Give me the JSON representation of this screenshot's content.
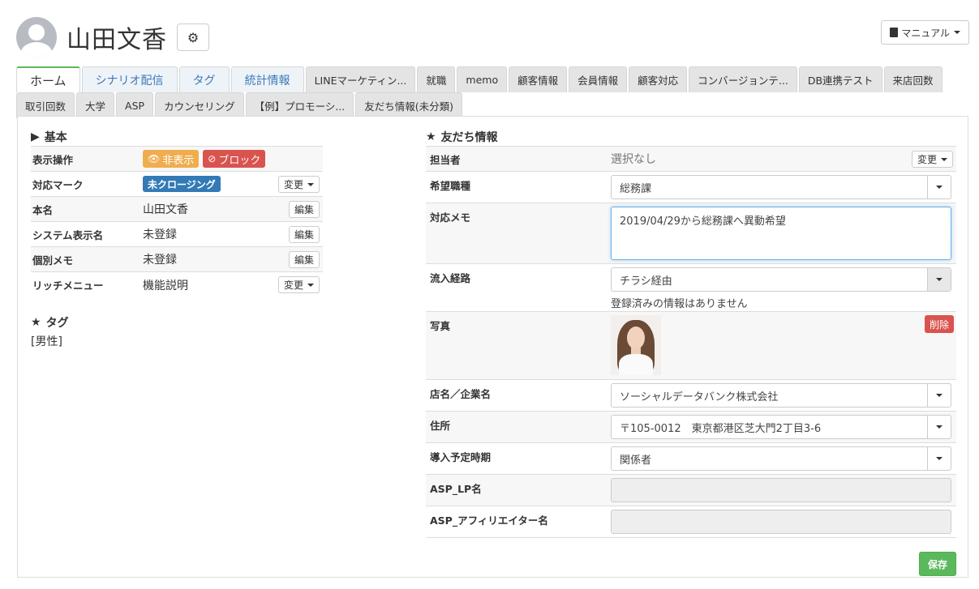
{
  "header": {
    "user_name": "山田文香",
    "manual_label": "マニュアル"
  },
  "tabs": {
    "row1": [
      {
        "label": "ホーム",
        "style": "active"
      },
      {
        "label": "シナリオ配信",
        "style": "blue"
      },
      {
        "label": "タグ",
        "style": "blue"
      },
      {
        "label": "統計情報",
        "style": "blue"
      },
      {
        "label": "LINEマーケティン...",
        "style": "grey"
      },
      {
        "label": "就職",
        "style": "grey"
      },
      {
        "label": "memo",
        "style": "grey"
      },
      {
        "label": "顧客情報",
        "style": "grey"
      },
      {
        "label": "会員情報",
        "style": "grey"
      },
      {
        "label": "顧客対応",
        "style": "grey"
      },
      {
        "label": "コンバージョンテ...",
        "style": "grey"
      },
      {
        "label": "DB連携テスト",
        "style": "grey"
      },
      {
        "label": "来店回数",
        "style": "grey"
      }
    ],
    "row2": [
      {
        "label": "取引回数",
        "style": "grey"
      },
      {
        "label": "大学",
        "style": "grey"
      },
      {
        "label": "ASP",
        "style": "grey"
      },
      {
        "label": "カウンセリング",
        "style": "grey"
      },
      {
        "label": "【例】プロモーシ...",
        "style": "grey"
      },
      {
        "label": "友だち情報(未分類)",
        "style": "grey"
      }
    ]
  },
  "basic": {
    "title": "基本",
    "rows": {
      "display_ops": {
        "label": "表示操作",
        "hide_label": "非表示",
        "block_label": "ブロック"
      },
      "mark": {
        "label": "対応マーク",
        "badge": "未クロージング",
        "action": "変更"
      },
      "real_name": {
        "label": "本名",
        "value": "山田文香",
        "action": "編集"
      },
      "system_name": {
        "label": "システム表示名",
        "value": "未登録",
        "action": "編集"
      },
      "memo": {
        "label": "個別メモ",
        "value": "未登録",
        "action": "編集"
      },
      "rich_menu": {
        "label": "リッチメニュー",
        "value": "機能説明",
        "action": "変更"
      }
    }
  },
  "tags": {
    "title": "タグ",
    "value": "[男性]"
  },
  "friend_info": {
    "title": "友だち情報",
    "staff": {
      "label": "担当者",
      "value": "選択なし",
      "action": "変更"
    },
    "job": {
      "label": "希望職種",
      "value": "総務課"
    },
    "memo": {
      "label": "対応メモ",
      "value": "2019/04/29から総務課へ異動希望"
    },
    "source": {
      "label": "流入経路",
      "value": "チラシ経由",
      "help": "登録済みの情報はありません"
    },
    "photo": {
      "label": "写真",
      "delete_label": "削除"
    },
    "company": {
      "label": "店名／企業名",
      "value": "ソーシャルデータバンク株式会社"
    },
    "address": {
      "label": "住所",
      "value": "〒105-0012　東京都港区芝大門2丁目3-6"
    },
    "timing": {
      "label": "導入予定時期",
      "value": "関係者"
    },
    "asp_lp": {
      "label": "ASP_LP名",
      "value": ""
    },
    "asp_affiliate": {
      "label": "ASP_アフィリエイター名",
      "value": ""
    },
    "save_label": "保存"
  }
}
